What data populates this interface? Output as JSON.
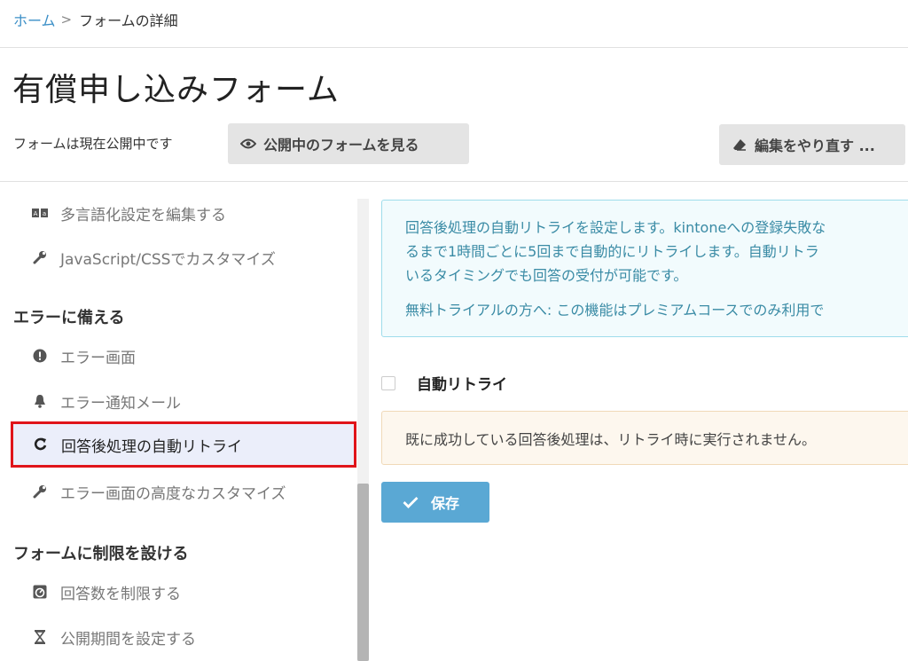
{
  "breadcrumb": {
    "home": "ホーム",
    "separator": ">",
    "current": "フォームの詳細"
  },
  "page_title": "有償申し込みフォーム",
  "status": {
    "text": "フォームは現在公開中です",
    "view_button": "公開中のフォームを見る",
    "redo_button": "編集をやり直す ..."
  },
  "sidebar": {
    "items_top": [
      {
        "label": "多言語化設定を編集する",
        "icon": "translate-icon"
      },
      {
        "label": "JavaScript/CSSでカスタマイズ",
        "icon": "wrench-icon"
      }
    ],
    "section_error": "エラーに備える",
    "items_error": [
      {
        "label": "エラー画面",
        "icon": "exclamation-icon"
      },
      {
        "label": "エラー通知メール",
        "icon": "bell-icon"
      },
      {
        "label": "回答後処理の自動リトライ",
        "icon": "refresh-icon",
        "active": true
      },
      {
        "label": "エラー画面の高度なカスタマイズ",
        "icon": "wrench-icon"
      }
    ],
    "section_limit": "フォームに制限を設ける",
    "items_limit": [
      {
        "label": "回答数を制限する",
        "icon": "gauge-icon"
      },
      {
        "label": "公開期間を設定する",
        "icon": "hourglass-icon"
      }
    ]
  },
  "main": {
    "info_lines": [
      "回答後処理の自動リトライを設定します。kintoneへの登録失敗な",
      "るまで1時間ごとに5回まで自動的にリトライします。自動リトラ",
      "いるタイミングでも回答の受付が可能です。"
    ],
    "info_note": "無料トライアルの方へ: この機能はプレミアムコースでのみ利用で",
    "checkbox_label": "自動リトライ",
    "checkbox_checked": false,
    "warning": "既に成功している回答後処理は、リトライ時に実行されません。",
    "save_button": "保存"
  },
  "colors": {
    "link": "#3b8fc7",
    "active_border": "#e0141a",
    "active_bg": "#ebeefa",
    "info_text": "#3a8ba5",
    "save_button": "#5aa8d4"
  }
}
